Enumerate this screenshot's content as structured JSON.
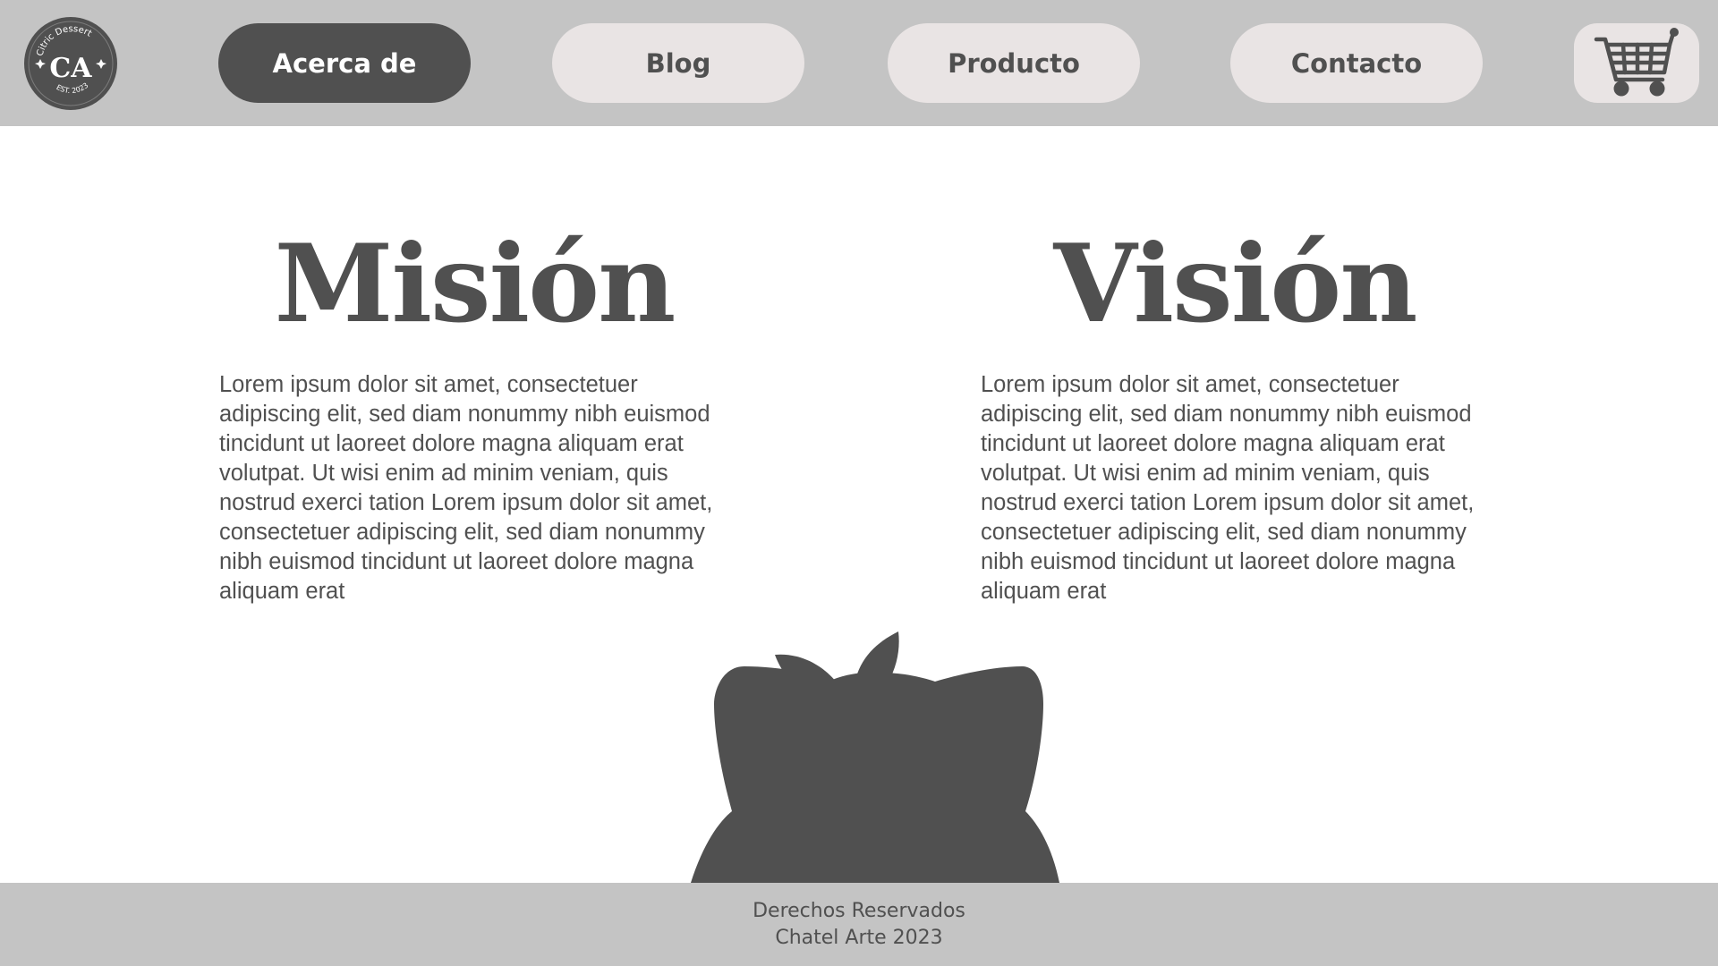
{
  "header": {
    "logo": {
      "icon": "citric-dessert-logo",
      "brand_text": "Citric Dessert",
      "monogram": "CA",
      "established": "EST. 2023"
    },
    "nav": [
      {
        "label": "Acerca de",
        "active": true
      },
      {
        "label": "Blog",
        "active": false
      },
      {
        "label": "Producto",
        "active": false
      },
      {
        "label": "Contacto",
        "active": false
      }
    ],
    "cart": {
      "icon": "shopping-cart-icon"
    }
  },
  "main": {
    "mision": {
      "title": "Misión",
      "text": "Lorem ipsum dolor sit amet, consectetuer adipiscing elit, sed diam nonummy nibh euismod tincidunt ut laoreet dolore magna aliquam erat volutpat. Ut wisi enim ad minim veniam, quis nostrud exerci tation Lorem ipsum dolor sit amet, consectetuer adipiscing elit, sed diam nonummy nibh euismod tincidunt ut laoreet dolore magna aliquam erat"
    },
    "vision": {
      "title": "Visión",
      "text": "Lorem ipsum dolor sit amet, consectetuer adipiscing elit, sed diam nonummy nibh euismod tincidunt ut laoreet dolore magna aliquam erat volutpat. Ut wisi enim ad minim veniam, quis nostrud exerci tation Lorem ipsum dolor sit amet, consectetuer adipiscing elit, sed diam nonummy nibh euismod tincidunt ut laoreet dolore magna aliquam erat"
    },
    "illustration": {
      "icon": "sprout-pot-illustration"
    }
  },
  "footer": {
    "line1": "Derechos Reservados",
    "line2": "Chatel Arte 2023"
  },
  "colors": {
    "header_bg": "#c4c4c4",
    "dark": "#505050",
    "button_light": "#e9e4e4",
    "page_bg": "#ffffff"
  }
}
